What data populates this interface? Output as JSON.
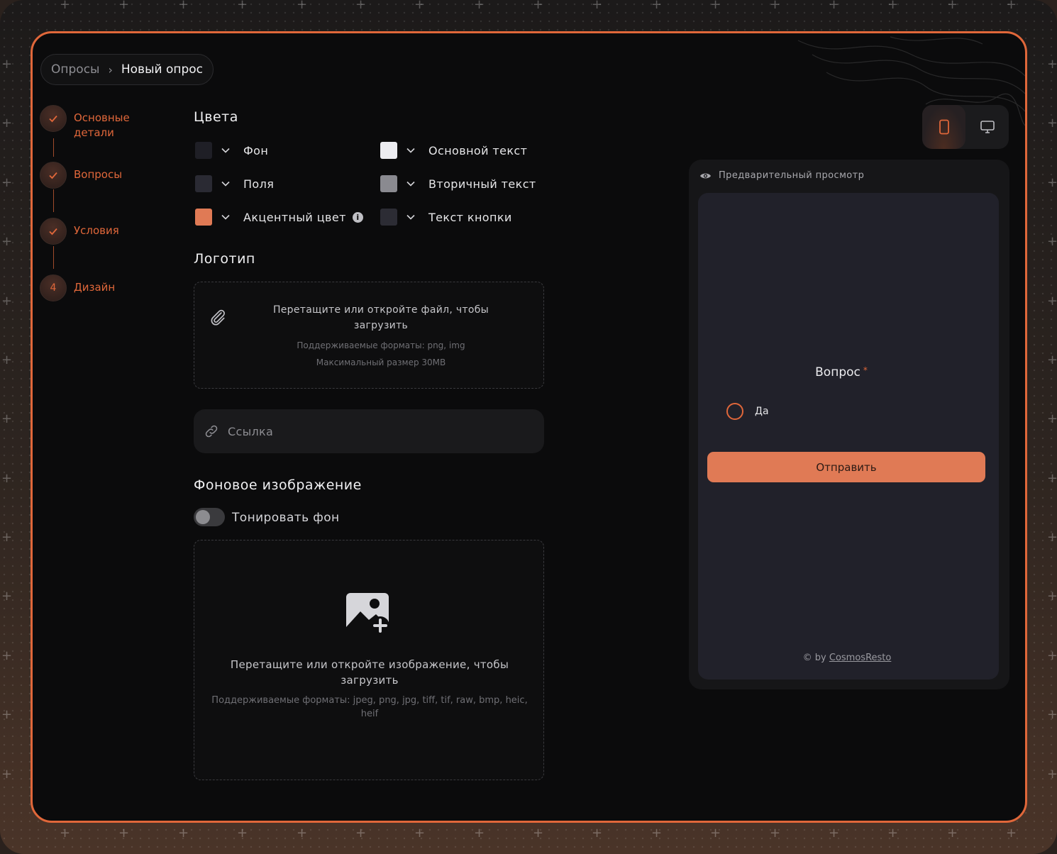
{
  "breadcrumb": {
    "parent": "Опросы",
    "separator": "›",
    "current": "Новый опрос"
  },
  "steps": [
    {
      "label_line1": "Основные",
      "label_line2": "детали",
      "state": "done",
      "icon": "check-icon"
    },
    {
      "label": "Вопросы",
      "state": "done",
      "icon": "check-icon"
    },
    {
      "label": "Условия",
      "state": "done",
      "icon": "check-icon"
    },
    {
      "label": "Дизайн",
      "number": "4",
      "state": "current"
    }
  ],
  "colors": {
    "title": "Цвета",
    "items": [
      {
        "label": "Фон",
        "value": "#1f1f26"
      },
      {
        "label": "Поля",
        "value": "#2a2a33"
      },
      {
        "label": "Акцентный цвет",
        "value": "#e07a55",
        "info": "i"
      },
      {
        "label": "Основной текст",
        "value": "#ececf0"
      },
      {
        "label": "Вторичный текст",
        "value": "#8a8a90"
      },
      {
        "label": "Текст кнопки",
        "value": "#2c2c34"
      }
    ]
  },
  "logo": {
    "title": "Логотип",
    "dropzone_main": "Перетащите или откройте файл, чтобы загрузить",
    "dropzone_formats": "Поддерживаемые форматы: png, img",
    "dropzone_size": "Максимальный размер 30MB",
    "link_placeholder": "Ссылка"
  },
  "background": {
    "title": "Фоновое изображение",
    "tint_label": "Тонировать фон",
    "tint_enabled": false,
    "dropzone_main": "Перетащите или откройте изображение, чтобы загрузить",
    "dropzone_formats": "Поддерживаемые форматы: jpeg, png, jpg, tiff, tif, raw, bmp, heic, heif"
  },
  "device_switch": {
    "options": [
      "mobile-icon",
      "desktop-icon"
    ],
    "active": "mobile-icon"
  },
  "preview": {
    "title": "Предварительный просмотр",
    "question": "Вопрос",
    "required_mark": "*",
    "option": "Да",
    "submit": "Отправить",
    "credit_prefix": "© by",
    "credit_link": "CosmosResto"
  },
  "theme": {
    "accent": "#e0673a",
    "frame_bg": "#0b0b0c"
  }
}
